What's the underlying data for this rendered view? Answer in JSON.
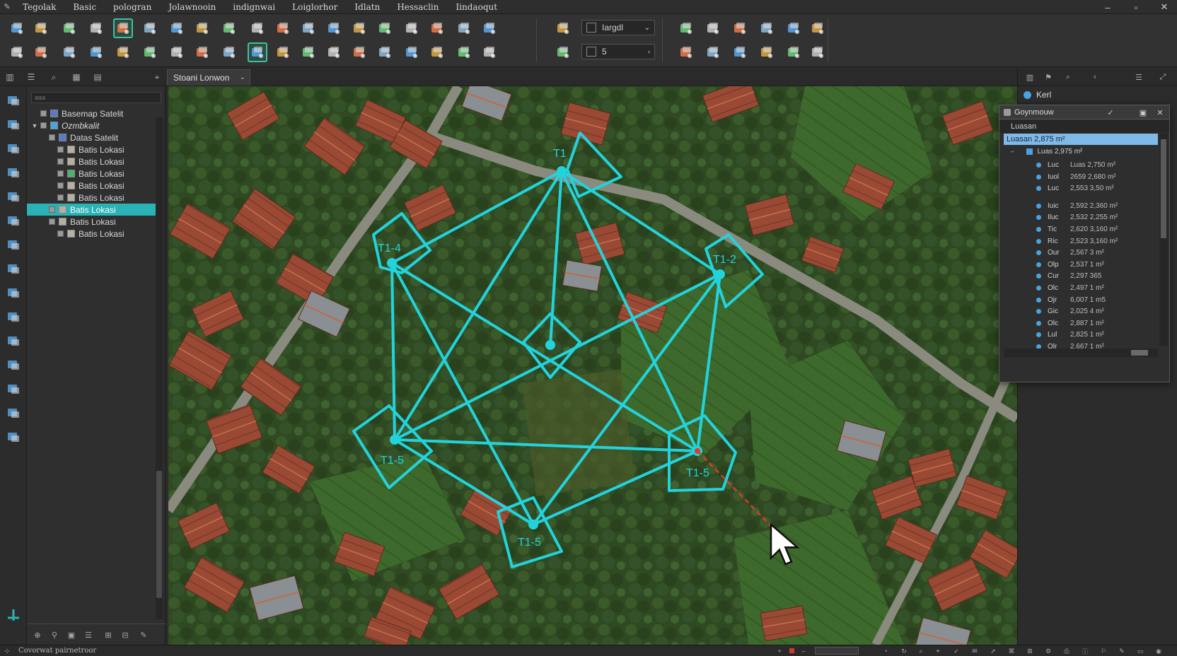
{
  "menu": {
    "items": [
      "Tegolak",
      "Basic",
      "pologran",
      "Jolawnooin",
      "indignwai",
      "Loiglorhor",
      "Idlatn",
      "Hessaclin",
      "Iindaoqut"
    ]
  },
  "toolbar": {
    "style_select_value": "Iargdl",
    "size_select_value": "5"
  },
  "tabs": {
    "map_tab_label": "Stoani Lonwon"
  },
  "layers": {
    "search_placeholder": "aaa",
    "items": [
      {
        "label": "Basemap Satelit",
        "indent": 0,
        "expander": "",
        "type": "raster"
      },
      {
        "label": "Ozmbkalit",
        "indent": 0,
        "expander": "▼",
        "type": "group"
      },
      {
        "label": "Datas Satelit",
        "indent": 1,
        "expander": "",
        "type": "raster"
      },
      {
        "label": "Batis Lokasi",
        "indent": 2,
        "expander": "",
        "type": "vector"
      },
      {
        "label": "Batis Lokasi",
        "indent": 2,
        "expander": "",
        "type": "vector"
      },
      {
        "label": "Batis Lokasi",
        "indent": 2,
        "expander": "",
        "type": "vector-green"
      },
      {
        "label": "Batis Lokasi",
        "indent": 2,
        "expander": "",
        "type": "vector"
      },
      {
        "label": "Batis Lokasi",
        "indent": 2,
        "expander": "",
        "type": "vector"
      },
      {
        "label": "Batis Lokasi",
        "indent": 1,
        "expander": "",
        "type": "vector",
        "selected": true
      },
      {
        "label": "Batis Lokasi",
        "indent": 1,
        "expander": "",
        "type": "vector"
      },
      {
        "label": "Batis Lokasi",
        "indent": 2,
        "expander": "",
        "type": "vector"
      }
    ]
  },
  "map": {
    "labels": {
      "t1": "T1",
      "t1_4": "T1-4",
      "t1_2": "T1-2",
      "t1_5_left": "T1-5",
      "t1_5_bottom": "T1-5",
      "t1_5_right": "T1-5"
    },
    "overlay_color": "#22d3dc",
    "measure_line_color": "#e03a2a"
  },
  "right_dock": {
    "layer_label": "Kerl"
  },
  "results_panel": {
    "title": "Goynmouw",
    "subtitle": "Luasan",
    "selected_row": "Luasan 2,875 m²",
    "node_label": "Luas 2,975 m²",
    "rows": [
      {
        "label": "Luc",
        "value": "Luas 2,750 m²"
      },
      {
        "label": "Iuol",
        "value": "2659 2,680 m²"
      },
      {
        "label": "Luc",
        "value": "2,553 3,50 m²"
      },
      {
        "label": "Iuic",
        "value": "2,592 2,360 m²"
      },
      {
        "label": "Iluc",
        "value": "2,532 2,255 m²"
      },
      {
        "label": "Tic",
        "value": "2,620 3,160 m²"
      },
      {
        "label": "Ric",
        "value": "2,523 3,160 m²"
      },
      {
        "label": "Our",
        "value": "2,567 3 m²"
      },
      {
        "label": "Olp",
        "value": "2,537 1 m²"
      },
      {
        "label": "Cur",
        "value": "2,297 365"
      },
      {
        "label": "Olc",
        "value": "2,497 1 m²"
      },
      {
        "label": "Ojr",
        "value": "6,007 1 m5"
      },
      {
        "label": "Gic",
        "value": "2,025 4 m²"
      },
      {
        "label": "Olc",
        "value": "2,887 1 m²"
      },
      {
        "label": "Lul",
        "value": "2,825 1 m²"
      },
      {
        "label": "Olr",
        "value": "2,667 1 m²"
      }
    ]
  },
  "status": {
    "text": "Covorwat pairnetroor"
  },
  "colors": {
    "accent_teal": "#2bb2b4",
    "selection_blue": "#7fb9e8",
    "icon_blue": "#4aa3e0"
  }
}
